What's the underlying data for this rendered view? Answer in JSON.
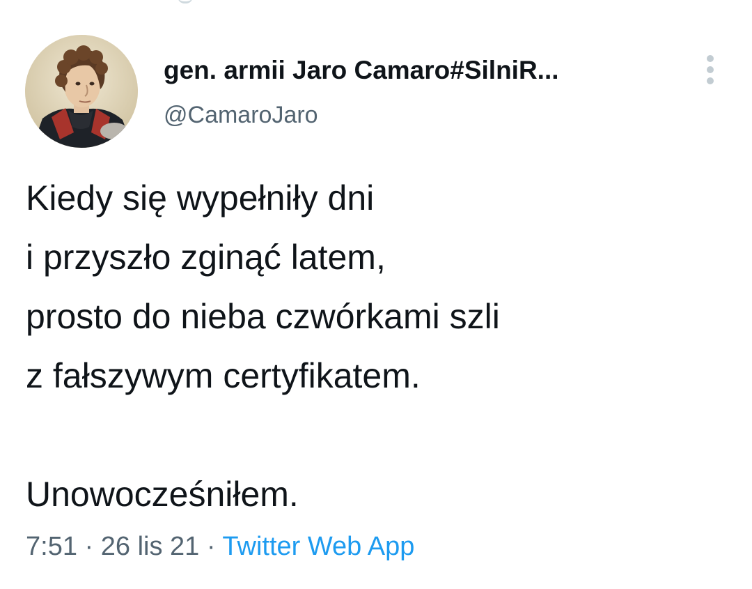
{
  "author": {
    "display_name": "gen. armii Jaro Camaro#SilniR...",
    "handle": "@CamaroJaro",
    "avatar_icon": "portrait-avatar"
  },
  "more_button": {
    "icon": "more-vertical-icon"
  },
  "tweet": {
    "lines": [
      "Kiedy się wypełniły dni",
      "i przyszło zginąć latem,",
      "prosto do nieba czwórkami szli",
      "z fałszywym certyfikatem.",
      "",
      "Unowocześniłem."
    ]
  },
  "meta": {
    "time": "7:51",
    "separator1": " · ",
    "date": "26 lis 21",
    "separator2": " · ",
    "source": "Twitter Web App"
  },
  "colors": {
    "text": "#0f1419",
    "secondary": "#536471",
    "link": "#1d9bf0"
  }
}
